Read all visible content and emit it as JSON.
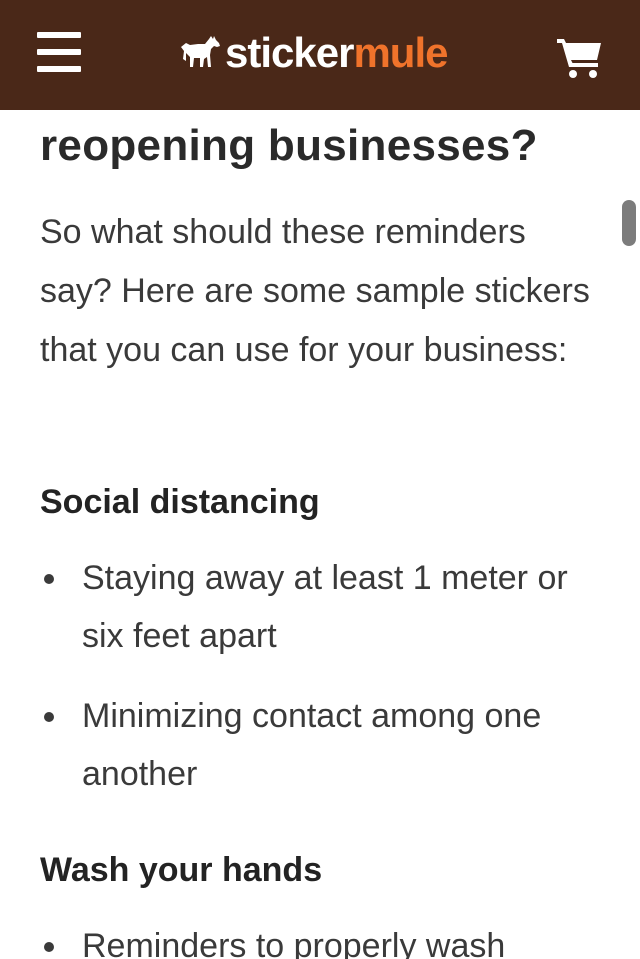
{
  "header": {
    "logo_part1": "sticker",
    "logo_part2": "mule",
    "menu_icon": "hamburger-menu-icon",
    "cart_icon": "cart-icon",
    "colors": {
      "bar": "#4a2818",
      "accent": "#f0732b",
      "text": "#ffffff"
    }
  },
  "article": {
    "heading": "reopening businesses?",
    "intro": "So what should these reminders say? Here are some sample stickers that you can use for your business:",
    "section1": {
      "title": "Social distancing",
      "items": [
        "Staying away at least 1 meter or six feet apart",
        "Minimizing contact among one another"
      ]
    },
    "section2": {
      "title": "Wash your hands",
      "items": [
        "Reminders to properly wash"
      ]
    }
  }
}
